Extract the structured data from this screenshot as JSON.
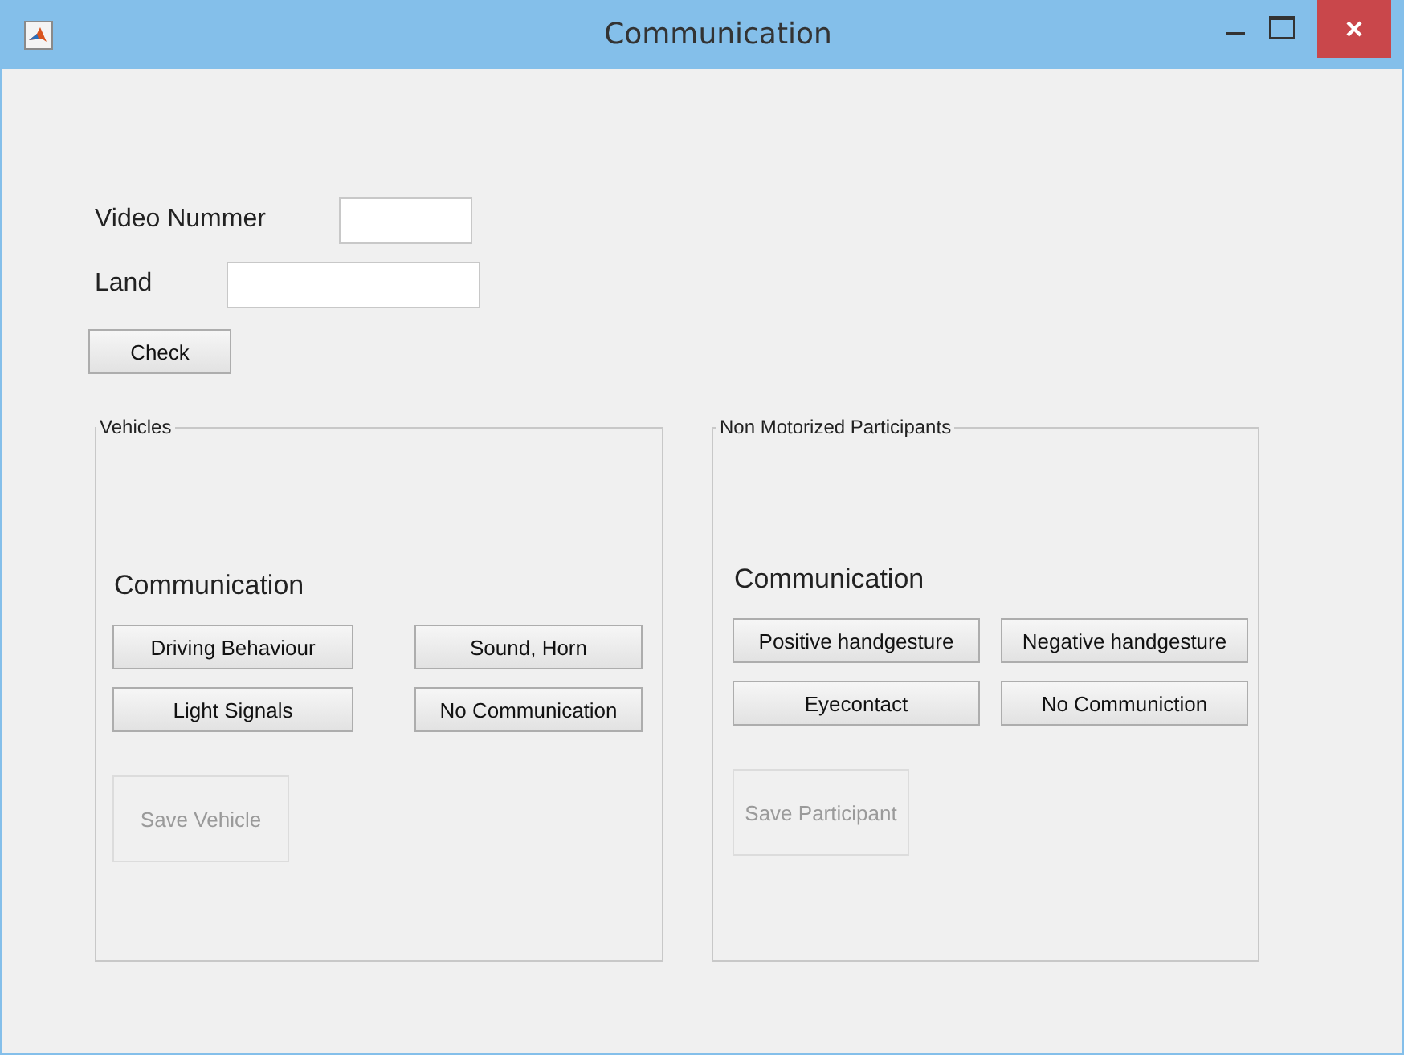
{
  "window": {
    "title": "Communication"
  },
  "fields": [
    {
      "label": "Video Nummer"
    },
    {
      "label": "Land"
    }
  ],
  "check_button": {
    "label": "Check"
  },
  "panels": [
    {
      "title": "Vehicles",
      "heading": "Communication",
      "buttons": [
        {
          "label": "Driving Behaviour"
        },
        {
          "label": "Sound, Horn"
        },
        {
          "label": "Light Signals"
        },
        {
          "label": "No Communication"
        }
      ],
      "save_button": {
        "label": "Save Vehicle",
        "disabled": true
      }
    },
    {
      "title": "Non Motorized Participants",
      "heading": "Communication",
      "buttons": [
        {
          "label": "Positive handgesture"
        },
        {
          "label": "Negative handgesture"
        },
        {
          "label": "Eyecontact"
        },
        {
          "label": "No Communiction"
        }
      ],
      "save_button": {
        "label": "Save Participant",
        "disabled": true
      }
    }
  ]
}
